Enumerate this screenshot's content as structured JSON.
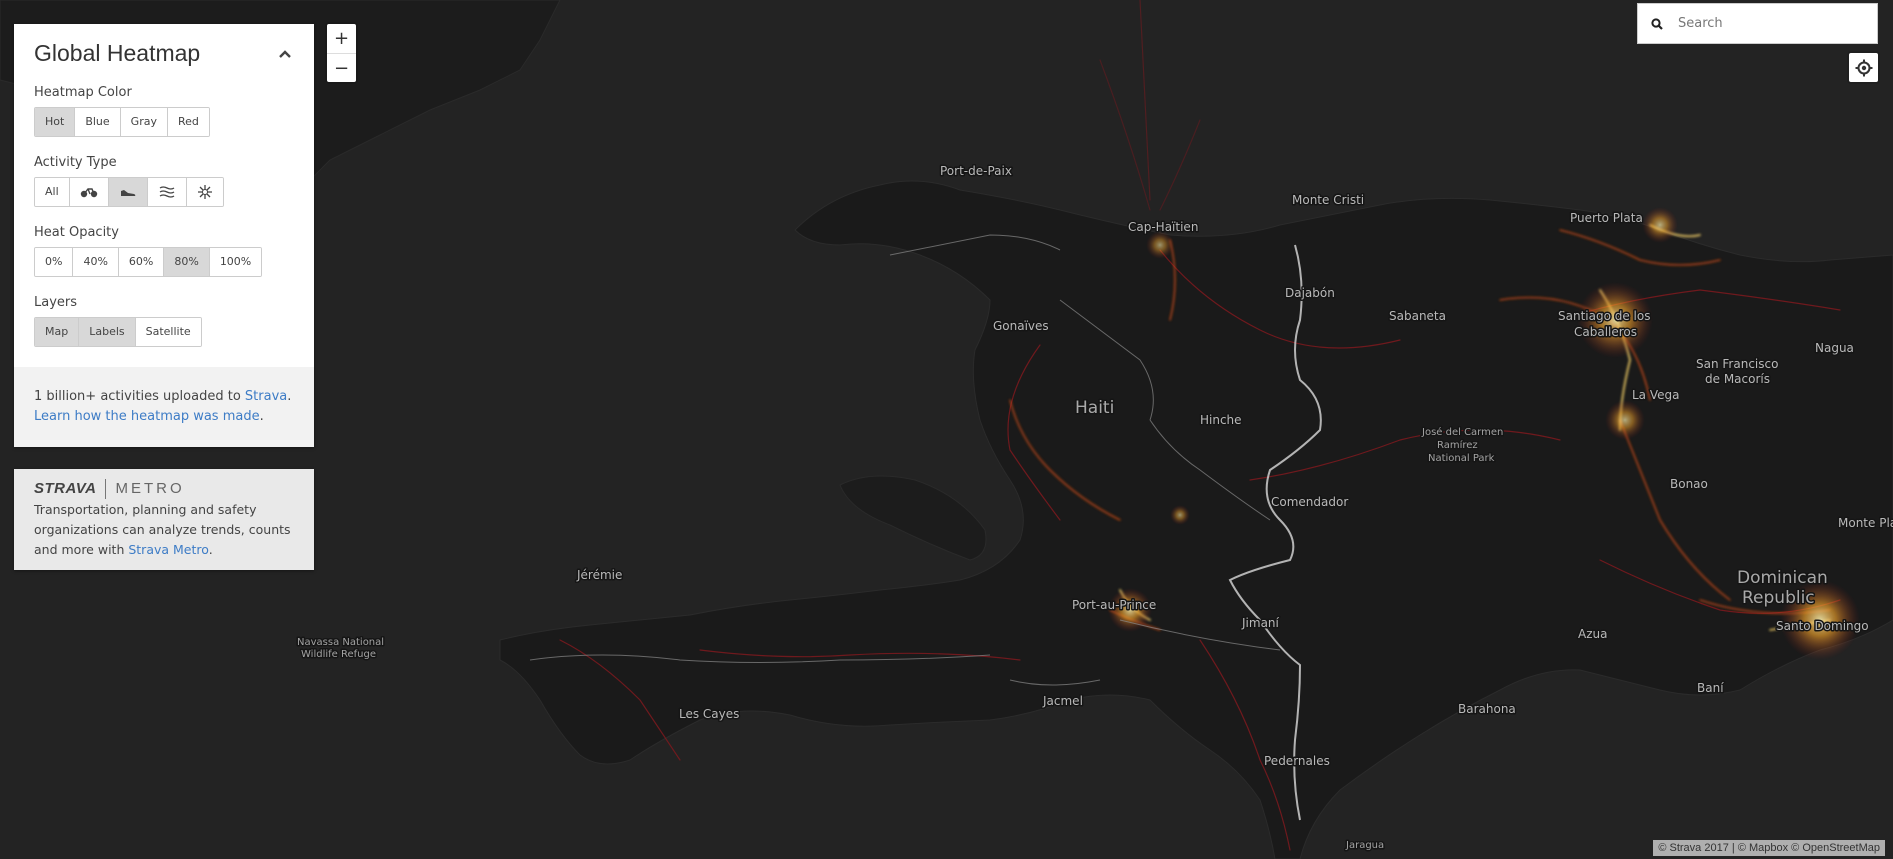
{
  "panel": {
    "title": "Global Heatmap",
    "collapse_icon": "chevron-up-icon",
    "heatmap_color": {
      "label": "Heatmap Color",
      "options": [
        "Hot",
        "Blue",
        "Gray",
        "Red"
      ],
      "selected": "Hot"
    },
    "activity_type": {
      "label": "Activity Type",
      "all_label": "All",
      "icons": [
        "bike-icon",
        "shoe-icon",
        "water-icon",
        "snowflake-icon"
      ],
      "selected": "shoe-icon"
    },
    "heat_opacity": {
      "label": "Heat Opacity",
      "options": [
        "0%",
        "40%",
        "60%",
        "80%",
        "100%"
      ],
      "selected": "80%"
    },
    "layers": {
      "label": "Layers",
      "options": [
        "Map",
        "Labels",
        "Satellite"
      ],
      "selected": [
        "Map",
        "Labels"
      ]
    },
    "info": {
      "text1": "1 billion+ activities uploaded to ",
      "strava_link": "Strava",
      "period": ".",
      "learn_link": "Learn how the heatmap was made",
      "period2": "."
    }
  },
  "metro": {
    "logo_strava": "STRAVA",
    "logo_metro": "METRO",
    "text": "Transportation, planning and safety organizations can analyze trends, counts and more with ",
    "link": "Strava Metro",
    "period": "."
  },
  "zoom": {
    "in": "+",
    "out": "−"
  },
  "search": {
    "placeholder": "Search",
    "value": ""
  },
  "attribution": {
    "strava": "© Strava 2017",
    "sep": " | ",
    "mapbox": "© Mapbox",
    "osm": "© OpenStreetMap"
  },
  "map": {
    "colors": {
      "water": "#232323",
      "land": "#1b1b1b",
      "heat_dim": "#8a1d1d",
      "heat_mid": "#d65a14",
      "heat_hot": "#ffd96a",
      "border": "#cfcfcf"
    },
    "labels": {
      "haiti": "Haiti",
      "dominican_republic_1": "Dominican",
      "dominican_republic_2": "Republic",
      "port_de_paix": "Port-de-Paix",
      "cap_haitien": "Cap-Haïtien",
      "monte_cristi": "Monte Cristi",
      "puerto_plata": "Puerto Plata",
      "dajabon": "Dajabón",
      "gonaives": "Gonaïves",
      "sabaneta": "Sabaneta",
      "santiago_1": "Santiago de los",
      "santiago_2": "Caballeros",
      "nagua": "Nagua",
      "sfm_1": "San Francisco",
      "sfm_2": "de Macorís",
      "la_vega": "La Vega",
      "hinche": "Hinche",
      "jose_1": "José del Carmen",
      "jose_2": "Ramírez",
      "jose_3": "National Park",
      "bonao": "Bonao",
      "monte_plata": "Monte Pla",
      "comendador": "Comendador",
      "jeremie": "Jérémie",
      "port_au_prince": "Port-au-Prince",
      "jimani": "Jimaní",
      "azua": "Azua",
      "santo_domingo": "Santo Domingo",
      "bani": "Baní",
      "navassa_1": "Navassa National",
      "navassa_2": "Wildlife Refuge",
      "les_cayes": "Les Cayes",
      "jacmel": "Jacmel",
      "barahona": "Barahona",
      "pedernales": "Pedernales",
      "jaragua": "Jaragua"
    }
  }
}
